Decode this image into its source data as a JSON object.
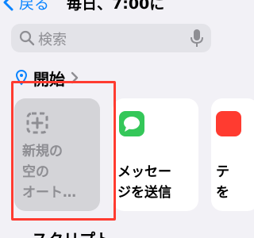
{
  "nav": {
    "back_label": "戻る",
    "title": "毎日、7:00に"
  },
  "search": {
    "placeholder": "検索"
  },
  "section": {
    "title": "開始"
  },
  "cards": {
    "new_automation": {
      "lines": [
        "新規の",
        "空の",
        "オート…"
      ]
    },
    "send_message": {
      "lines": [
        "メッセー",
        "ジを送信"
      ]
    },
    "third": {
      "lines": [
        "テ",
        "を"
      ]
    }
  },
  "next_section": {
    "title": "スクリプト"
  },
  "colors": {
    "accent": "#0a84ff",
    "background": "#f2f1f6",
    "highlight": "#ff3b30",
    "messages_green": "#34c759"
  }
}
